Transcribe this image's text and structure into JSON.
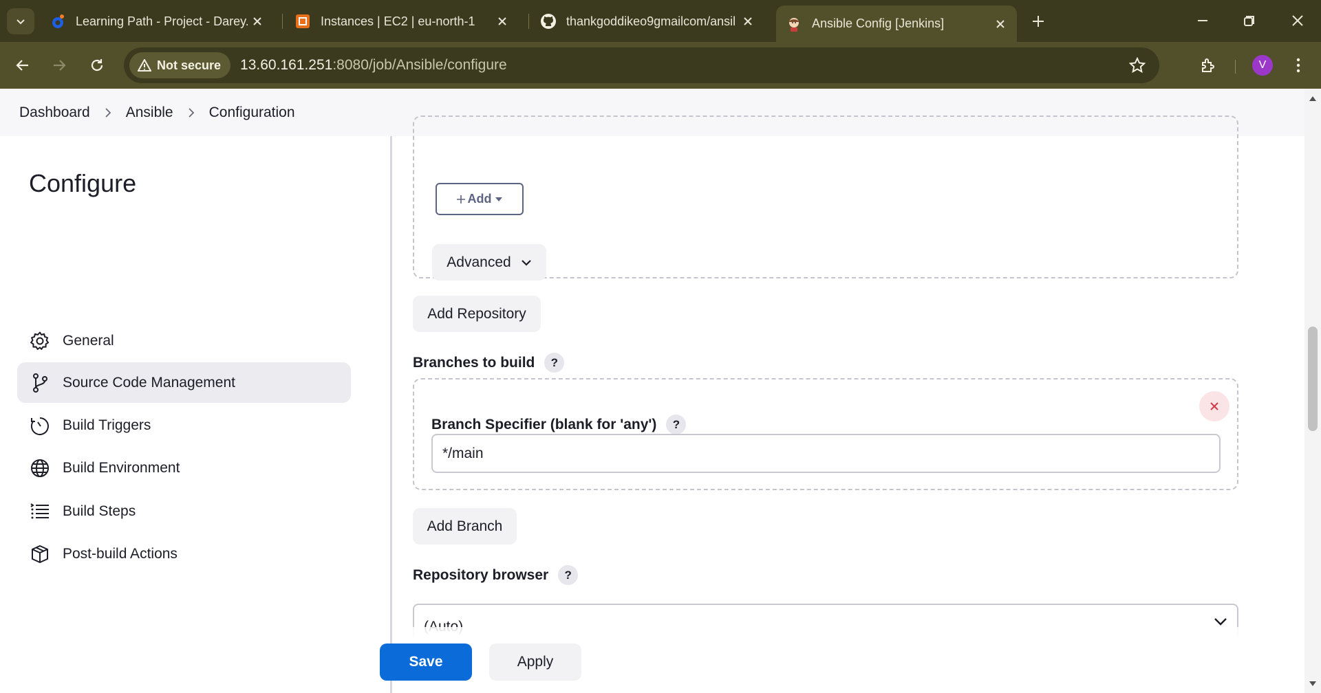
{
  "browser": {
    "tabs": [
      {
        "title": "Learning Path - Project - Darey.",
        "favicon": "darey-logo-icon",
        "active": false
      },
      {
        "title": "Instances | EC2 | eu-north-1",
        "favicon": "aws-ec2-icon",
        "active": false
      },
      {
        "title": "thankgoddikeo9gmailcom/ansil",
        "favicon": "github-icon",
        "active": false
      },
      {
        "title": "Ansible Config [Jenkins]",
        "favicon": "jenkins-icon",
        "active": true
      }
    ],
    "security_label": "Not secure",
    "url_host": "13.60.161.251",
    "url_path": ":8080/job/Ansible/configure",
    "profile_initial": "V"
  },
  "breadcrumbs": [
    "Dashboard",
    "Ansible",
    "Configuration"
  ],
  "sidebar": {
    "title": "Configure",
    "items": [
      {
        "label": "General",
        "icon": "gear-icon",
        "active": false
      },
      {
        "label": "Source Code Management",
        "icon": "git-branch-icon",
        "active": true
      },
      {
        "label": "Build Triggers",
        "icon": "clock-icon",
        "active": false
      },
      {
        "label": "Build Environment",
        "icon": "globe-icon",
        "active": false
      },
      {
        "label": "Build Steps",
        "icon": "list-icon",
        "active": false
      },
      {
        "label": "Post-build Actions",
        "icon": "package-icon",
        "active": false
      }
    ]
  },
  "main": {
    "add_label": "Add",
    "advanced_label": "Advanced",
    "add_repository_label": "Add Repository",
    "branches_label": "Branches to build",
    "branch_specifier_label": "Branch Specifier (blank for 'any')",
    "branch_specifier_value": "*/main",
    "add_branch_label": "Add Branch",
    "repo_browser_label": "Repository browser",
    "repo_browser_value": "(Auto)",
    "help_glyph": "?"
  },
  "footer": {
    "save_label": "Save",
    "apply_label": "Apply"
  },
  "colors": {
    "chrome_dark": "#3b3a1e",
    "chrome_toolbar": "#52502a",
    "primary": "#0b6bd8",
    "active_nav": "#ebebf0",
    "danger": "#d33a4a"
  }
}
